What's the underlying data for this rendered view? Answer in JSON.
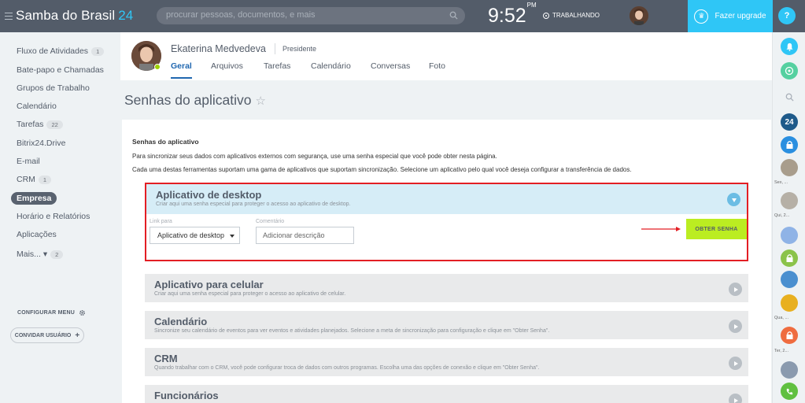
{
  "topbar": {
    "logo_main": "Samba do Brasil",
    "logo_num": "24",
    "search_placeholder": "procurar pessoas, documentos, e mais",
    "time": "9:52",
    "time_suffix": "PM",
    "status": "TRABALHANDO",
    "upgrade_label": "Fazer upgrade",
    "help": "?"
  },
  "leftmenu": {
    "items": [
      {
        "label": "Fluxo de Atividades",
        "count": "1"
      },
      {
        "label": "Bate-papo e Chamadas"
      },
      {
        "label": "Grupos de Trabalho"
      },
      {
        "label": "Calendário"
      },
      {
        "label": "Tarefas",
        "count": "22"
      },
      {
        "label": "Bitrix24.Drive"
      },
      {
        "label": "E-mail"
      },
      {
        "label": "CRM",
        "count": "1"
      },
      {
        "label": "Empresa"
      },
      {
        "label": "Horário e Relatórios"
      },
      {
        "label": "Aplicações"
      },
      {
        "label": "Mais... ▾",
        "count": "2"
      }
    ],
    "configure_label": "CONFIGURAR MENU",
    "invite_label": "CONVIDAR USUÁRIO"
  },
  "profile": {
    "name": "Ekaterina Medvedeva",
    "role": "Presidente",
    "tabs": [
      "Geral",
      "Arquivos",
      "Tarefas",
      "Calendário",
      "Conversas",
      "Foto"
    ]
  },
  "page": {
    "title": "Senhas do aplicativo",
    "star": "☆",
    "section_title": "Senhas do aplicativo",
    "desc1": "Para sincronizar seus dados com aplicativos externos com segurança, use uma senha especial que você pode obter nesta página.",
    "desc2": "Cada uma destas ferramentas suportam uma gama de aplicativos que suportam sincronização. Selecione um aplicativo pelo qual você deseja configurar a transferência de dados."
  },
  "sections": {
    "desktop": {
      "title": "Aplicativo de desktop",
      "subtitle": "Criar aqui uma senha especial para proteger o acesso ao aplicativo de desktop.",
      "link_label": "Link para",
      "link_value": "Aplicativo de desktop",
      "comment_label": "Comentário",
      "comment_placeholder": "Adicionar descrição",
      "button": "OBTER SENHA"
    },
    "mobile": {
      "title": "Aplicativo para celular",
      "subtitle": "Criar aqui uma senha especial para proteger o acesso ao aplicativo de celular."
    },
    "calendar": {
      "title": "Calendário",
      "subtitle": "Sincronize seu calendário de eventos para ver eventos e atividades planejados. Selecione a meta de sincronização para configuração e clique em \"Obter Senha\"."
    },
    "crm": {
      "title": "CRM",
      "subtitle": "Quando trabalhar com o CRM, você pode configurar troca de dados com outros programas. Escolha uma das opções de conexão e clique em \"Obter Senha\"."
    },
    "employees": {
      "title": "Funcionários"
    }
  },
  "rightpanel": {
    "labels": [
      "Sex, ...",
      "Qui, 2...",
      "Qua, ...",
      "Ter, 2..."
    ],
    "badge_24": "24"
  },
  "colors": {
    "topbar": "#535c69",
    "accent": "#2fc6f6",
    "highlight_border": "#e31e24",
    "button_green": "#bbed21"
  }
}
